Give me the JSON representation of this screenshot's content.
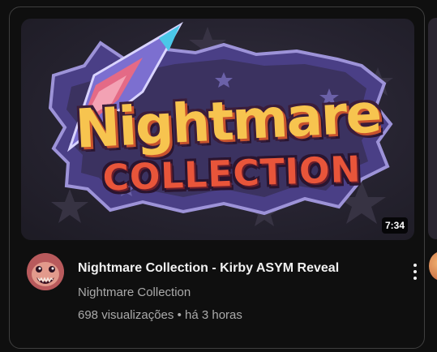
{
  "video": {
    "duration": "7:34",
    "title": "Nightmare Collection - Kirby ASYM Reveal",
    "channel": "Nightmare Collection",
    "views": "698 visualizações",
    "separator": "•",
    "age": "há 3 horas"
  },
  "thumbnail": {
    "logo_line1": "Nightmare",
    "logo_line2": "COLLECTION",
    "colors": {
      "background": "#2a2732",
      "logo_yellow": "#f7c44f",
      "logo_red": "#e8553a",
      "badge_purple": "#4a3f86"
    }
  },
  "icons": {
    "menu": "more-vert-icon"
  },
  "theme": {
    "page_bg": "#0f0f0f",
    "card_border": "#3f3f3f",
    "title_color": "#f1f1f1",
    "secondary_color": "#aaaaaa"
  }
}
